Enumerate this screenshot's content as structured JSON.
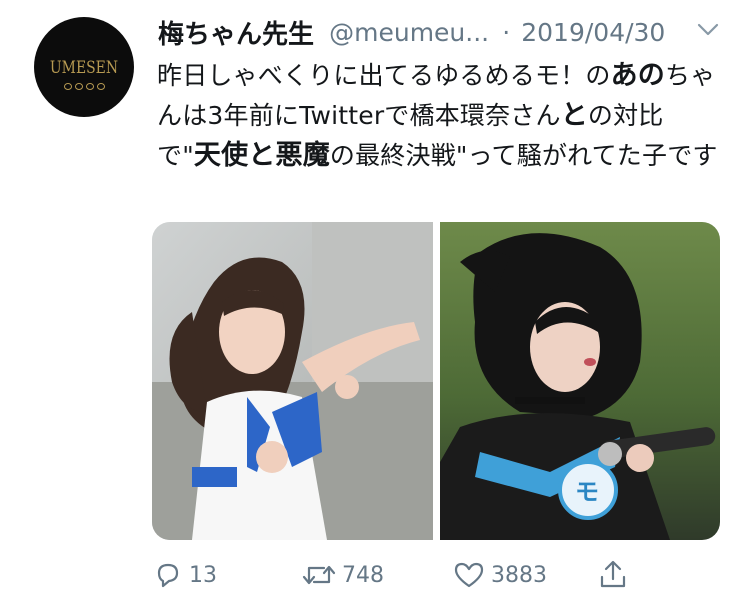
{
  "account": {
    "display_name": "梅ちゃん先生",
    "handle": "@meumeu...",
    "separator": "·",
    "date": "2019/04/30",
    "avatar_text": "UMESEN"
  },
  "tweet": {
    "text_parts": [
      "昨日しゃべくりに出てるゆるめるモ！の",
      "あの",
      "ちゃんは3年前にTwitterで橋本環奈さん",
      "と",
      "の対比で\"",
      "天使と悪魔",
      "の最終決戦\"って騒がれてた子です"
    ]
  },
  "media": {
    "left_photo": "idol-photo-left",
    "right_photo": "idol-photo-right"
  },
  "actions": {
    "reply_count": "13",
    "retweet_count": "748",
    "like_count": "3883"
  },
  "colors": {
    "text": "#14171a",
    "secondary": "#657786",
    "avatar_bg": "#0c0c0c",
    "avatar_gold": "#b79a52"
  }
}
